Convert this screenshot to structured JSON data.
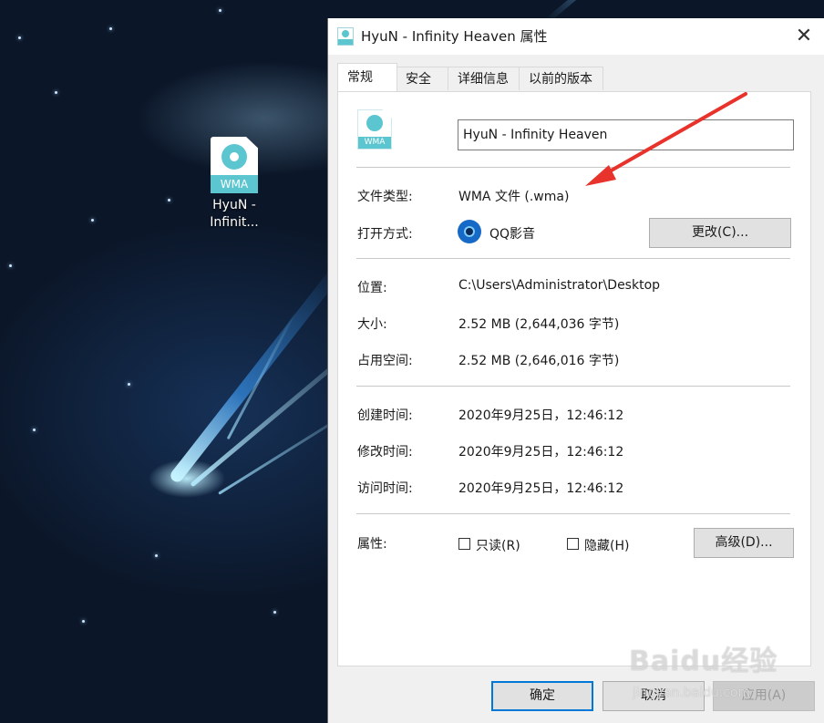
{
  "desktop": {
    "icon_label_line1": "HyuN -",
    "icon_label_line2": "Infinit...",
    "icon_tag": "WMA"
  },
  "dialog": {
    "title": "HyuN - Infinity Heaven 属性",
    "close_glyph": "✕",
    "tabs": [
      {
        "label": "常规",
        "active": true
      },
      {
        "label": "安全"
      },
      {
        "label": "详细信息"
      },
      {
        "label": "以前的版本"
      }
    ],
    "file_icon_tag": "WMA",
    "file_name": "HyuN - Infinity Heaven",
    "rows": {
      "file_type": {
        "label": "文件类型:",
        "value": "WMA 文件 (.wma)"
      },
      "opens_with": {
        "label": "打开方式:",
        "value": "QQ影音",
        "button": "更改(C)..."
      },
      "location": {
        "label": "位置:",
        "value": "C:\\Users\\Administrator\\Desktop"
      },
      "size": {
        "label": "大小:",
        "value": "2.52 MB (2,644,036 字节)"
      },
      "size_on_disk": {
        "label": "占用空间:",
        "value": "2.52 MB (2,646,016 字节)"
      },
      "created": {
        "label": "创建时间:",
        "value": "2020年9月25日，12:46:12"
      },
      "modified": {
        "label": "修改时间:",
        "value": "2020年9月25日，12:46:12"
      },
      "accessed": {
        "label": "访问时间:",
        "value": "2020年9月25日，12:46:12"
      },
      "attributes": {
        "label": "属性:",
        "readonly": "只读(R)",
        "hidden": "隐藏(H)",
        "advanced_button": "高级(D)..."
      }
    },
    "footer": {
      "ok": "确定",
      "cancel": "取消",
      "apply": "应用(A)"
    }
  },
  "watermark": {
    "text": "Baidu经验",
    "sub": "jingyan.baidu.com"
  },
  "colors": {
    "accent": "#0078d7",
    "file_icon": "#5cc6d0",
    "arrow": "#e8332c"
  }
}
